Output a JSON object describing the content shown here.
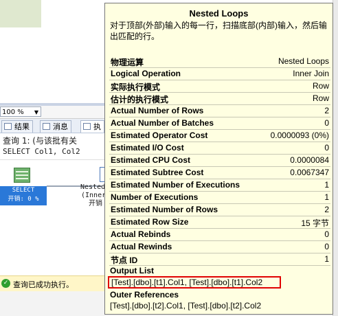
{
  "zoom": {
    "value": "100 %"
  },
  "tabs": [
    {
      "label": "结果"
    },
    {
      "label": "消息"
    },
    {
      "label": "执"
    }
  ],
  "query": {
    "line": "查询 1: (与该批有关",
    "sql": "SELECT Col1, Col2"
  },
  "plan": {
    "select_label": "SELECT",
    "select_cost": "开销: 0 %",
    "nested_label": "Nested",
    "nested_sub": "(Inner",
    "nested_cost": "开销"
  },
  "status": {
    "text": "查询已成功执行。"
  },
  "tooltip": {
    "title": "Nested Loops",
    "description": "对于顶部(外部)输入的每一行，扫描底部(内部)输入，然后输出匹配的行。",
    "rows": [
      {
        "k": "物理运算",
        "v": "Nested Loops"
      },
      {
        "k": "Logical Operation",
        "v": "Inner Join"
      },
      {
        "k": "实际执行模式",
        "v": "Row"
      },
      {
        "k": "估计的执行模式",
        "v": "Row"
      },
      {
        "k": "Actual Number of Rows",
        "v": "2"
      },
      {
        "k": "Actual Number of Batches",
        "v": "0"
      },
      {
        "k": "Estimated Operator Cost",
        "v": "0.0000093 (0%)"
      },
      {
        "k": "Estimated I/O Cost",
        "v": "0"
      },
      {
        "k": "Estimated CPU Cost",
        "v": "0.0000084"
      },
      {
        "k": "Estimated Subtree Cost",
        "v": "0.0067347"
      },
      {
        "k": "Estimated Number of Executions",
        "v": "1"
      },
      {
        "k": "Number of Executions",
        "v": "1"
      },
      {
        "k": "Estimated Number of Rows",
        "v": "2"
      },
      {
        "k": "Estimated Row Size",
        "v": "15 字节"
      },
      {
        "k": "Actual Rebinds",
        "v": "0"
      },
      {
        "k": "Actual Rewinds",
        "v": "0"
      },
      {
        "k": "节点 ID",
        "v": "1"
      }
    ],
    "output_label": "Output List",
    "output_value": "[Test].[dbo].[t1].Col1, [Test].[dbo].[t1].Col2",
    "outer_label": "Outer References",
    "outer_value": "[Test].[dbo].[t2].Col1, [Test].[dbo].[t2].Col2"
  }
}
